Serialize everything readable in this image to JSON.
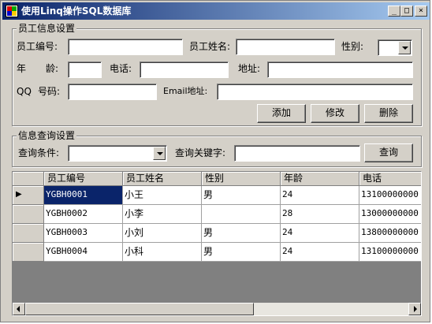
{
  "window": {
    "title": "使用Linq操作SQL数据库",
    "controls": {
      "minimize": "_",
      "maximize": "□",
      "close": "×"
    }
  },
  "employee_info": {
    "group_title": "员工信息设置",
    "id_label": "员工编号:",
    "id_value": "",
    "name_label": "员工姓名:",
    "name_value": "",
    "gender_label": "性别:",
    "gender_value": "",
    "age_label_1": "年",
    "age_label_2": "龄:",
    "age_value": "",
    "phone_label": "电话:",
    "phone_value": "",
    "address_label": "地址:",
    "address_value": "",
    "qq_label_1": "QQ",
    "qq_label_2": "号码:",
    "qq_value": "",
    "email_label": "Email地址:",
    "email_value": "",
    "add_button": "添加",
    "edit_button": "修改",
    "delete_button": "删除"
  },
  "query": {
    "group_title": "信息查询设置",
    "condition_label": "查询条件:",
    "condition_value": "",
    "keyword_label": "查询关键字:",
    "keyword_value": "",
    "query_button": "查询"
  },
  "grid": {
    "columns": [
      "员工编号",
      "员工姓名",
      "性别",
      "年龄",
      "电话"
    ],
    "rows": [
      [
        "YGBH0001",
        "小王",
        "男",
        "24",
        "13100000000"
      ],
      [
        "YGBH0002",
        "小李",
        "",
        "28",
        "13000000000"
      ],
      [
        "YGBH0003",
        "小刘",
        "男",
        "24",
        "13800000000"
      ],
      [
        "YGBH0004",
        "小科",
        "男",
        "24",
        "13100000000"
      ]
    ],
    "current_row_marker": "▶"
  },
  "colors": {
    "titlebar": "#0a246a",
    "selection": "#0a246a",
    "face": "#d4d0c8",
    "grid_background": "#808080"
  }
}
